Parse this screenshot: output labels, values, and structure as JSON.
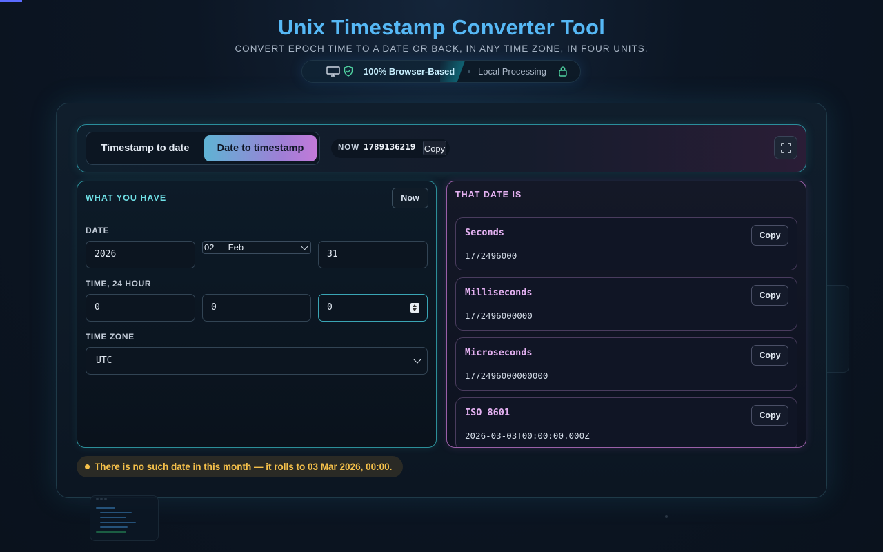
{
  "header": {
    "title": "Unix Timestamp Converter Tool",
    "subtitle": "CONVERT EPOCH TIME TO A DATE OR BACK, IN ANY TIME ZONE, IN FOUR UNITS.",
    "badge_browser": "100% Browser-Based",
    "badge_local": "Local Processing"
  },
  "toolbar": {
    "mode_a": "Timestamp to date",
    "mode_b": "Date to timestamp",
    "active_mode": "Date to timestamp",
    "now_label": "NOW",
    "now_value": "1789136219",
    "now_copy": "Copy"
  },
  "input_panel": {
    "title": "WHAT YOU HAVE",
    "now_button": "Now",
    "date_label": "DATE",
    "year": "2026",
    "month": "02 — Feb",
    "day": "31",
    "time_label": "TIME, 24 HOUR",
    "hour": "0",
    "minute": "0",
    "second": "0",
    "tz_label": "TIME ZONE",
    "tz": "UTC"
  },
  "output_panel": {
    "title": "THAT DATE IS",
    "results": [
      {
        "label": "Seconds",
        "value": "1772496000",
        "copy": "Copy"
      },
      {
        "label": "Milliseconds",
        "value": "1772496000000",
        "copy": "Copy"
      },
      {
        "label": "Microseconds",
        "value": "1772496000000000",
        "copy": "Copy"
      },
      {
        "label": "ISO 8601",
        "value": "2026-03-03T00:00:00.000Z",
        "copy": "Copy"
      }
    ]
  },
  "notice": "There is no such date in this month — it rolls to 03 Mar 2026, 00:00.",
  "colors": {
    "accent_cyan": "#6fe0e6",
    "accent_magenta": "#e3b0f1",
    "warning": "#f5c04a",
    "title_blue": "#56b8f5"
  }
}
